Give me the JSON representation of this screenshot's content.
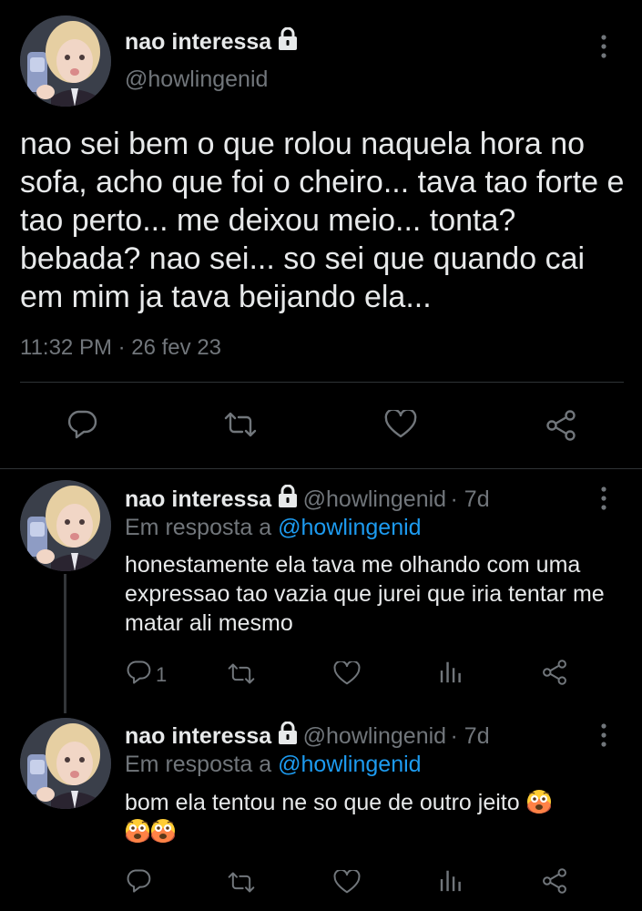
{
  "tweet": {
    "display_name": "nao interessa",
    "handle": "@howlingenid",
    "text": "nao sei bem o que rolou naquela hora no sofa, acho que foi o cheiro... tava tao forte e tao perto... me deixou meio... tonta? bebada? nao sei... so sei que quando cai em mim ja tava beijando ela...",
    "timestamp": "11:32 PM · 26 fev 23"
  },
  "replies": [
    {
      "display_name": "nao interessa",
      "handle": "@howlingenid",
      "age": "· 7d",
      "reply_prefix": "Em resposta a",
      "reply_to": "@howlingenid",
      "text": "honestamente ela tava me olhando com uma expressao tao vazia que jurei que iria tentar me matar ali mesmo",
      "reply_count": "1"
    },
    {
      "display_name": "nao interessa",
      "handle": "@howlingenid",
      "age": "· 7d",
      "reply_prefix": "Em resposta a",
      "reply_to": "@howlingenid",
      "text": "bom ela tentou ne so que de outro jeito",
      "reply_count": ""
    }
  ],
  "colors": {
    "background": "#000000",
    "text": "#e7e9ea",
    "muted": "#71767b",
    "link": "#1d9bf0",
    "divider": "#2f3336"
  },
  "icons": [
    "lock-icon",
    "more-icon",
    "reply-icon",
    "retweet-icon",
    "like-icon",
    "share-icon",
    "views-icon",
    "flushed-face-emoji"
  ]
}
